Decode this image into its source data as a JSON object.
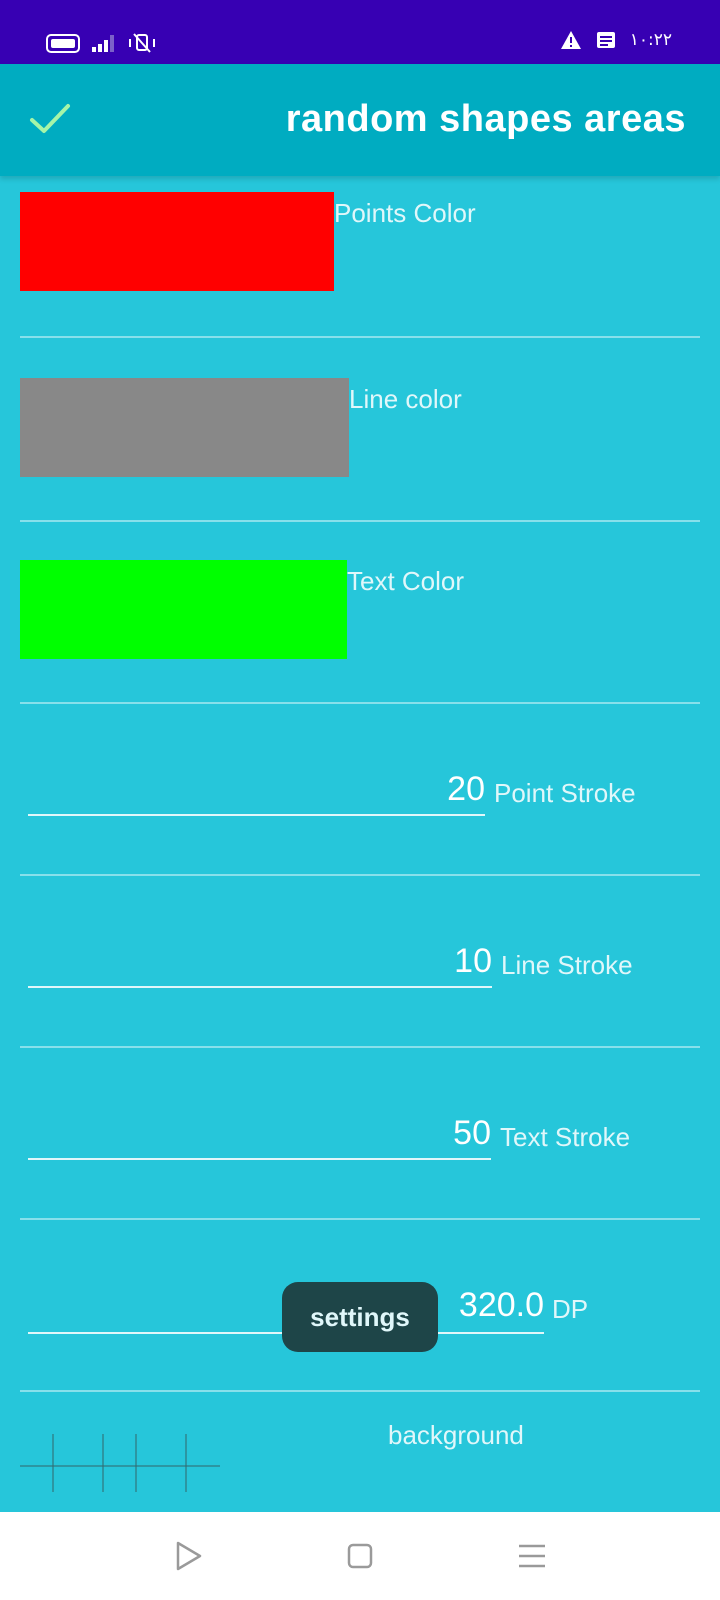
{
  "status_bar": {
    "time": "١٠:٢٢",
    "icons": [
      "battery-icon",
      "signal-icon",
      "vibrate-off-icon",
      "warning-icon",
      "notification-icon"
    ]
  },
  "app_bar": {
    "title": "random shapes areas",
    "confirm_icon": "check-icon"
  },
  "colors": {
    "points_label": "Points Color",
    "points_value": "#FF0000",
    "line_label": "Line color",
    "line_value": "#888888",
    "text_label": "Text Color",
    "text_value": "#00FF00"
  },
  "strokes": {
    "point_value": "20",
    "point_label": "Point Stroke",
    "line_value": "10",
    "line_label": "Line Stroke",
    "text_value": "50",
    "text_label": "Text Stroke"
  },
  "size": {
    "value": "320.0",
    "unit": "DP"
  },
  "toast": "settings",
  "background": {
    "label": "background"
  },
  "nav_bar": [
    "back-icon",
    "home-icon",
    "menu-icon"
  ]
}
